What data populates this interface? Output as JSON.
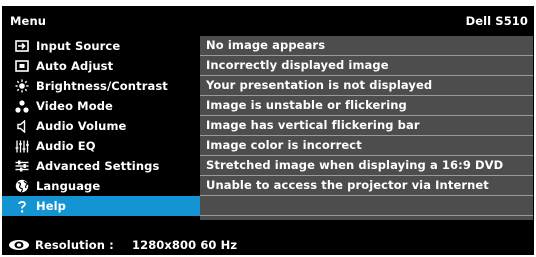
{
  "header": {
    "menu_title": "Menu",
    "model": "Dell S510"
  },
  "sidebar": {
    "items": [
      {
        "label": "Input Source",
        "icon": "input-source-icon"
      },
      {
        "label": "Auto Adjust",
        "icon": "auto-adjust-icon"
      },
      {
        "label": "Brightness/Contrast",
        "icon": "brightness-icon"
      },
      {
        "label": "Video Mode",
        "icon": "video-mode-icon"
      },
      {
        "label": "Audio Volume",
        "icon": "speaker-icon"
      },
      {
        "label": "Audio EQ",
        "icon": "equalizer-icon"
      },
      {
        "label": "Advanced Settings",
        "icon": "settings-sliders-icon"
      },
      {
        "label": "Language",
        "icon": "globe-icon"
      },
      {
        "label": "Help",
        "icon": "question-mark-icon"
      }
    ],
    "selected_index": 8
  },
  "help_topics": {
    "items": [
      "No image appears",
      "Incorrectly displayed image",
      "Your presentation is not displayed",
      "Image is unstable or flickering",
      "Image has vertical flickering bar",
      "Image color is incorrect",
      "Stretched image when displaying a 16:9 DVD",
      "Unable to access the projector via Internet"
    ]
  },
  "footer": {
    "resolution_label": "Resolution :",
    "resolution_value": "1280x800 60 Hz",
    "icon": "eye-icon"
  },
  "colors": {
    "background": "#000000",
    "selected": "#1594d4",
    "content_panel": "#4d4d4d",
    "divider": "#9a9a9a",
    "text": "#ffffff"
  }
}
